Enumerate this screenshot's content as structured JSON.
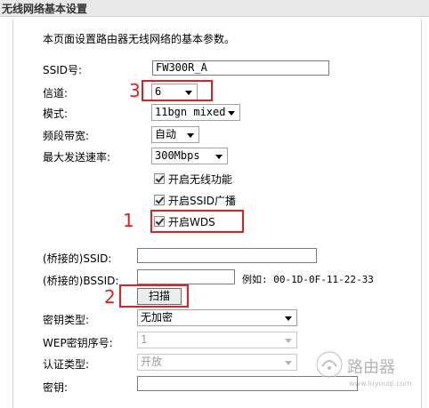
{
  "title": "无线网络基本设置",
  "intro": "本页面设置路由器无线网络的基本参数。",
  "fields": {
    "ssid": {
      "label": "SSID号:",
      "value": "FW300R_A"
    },
    "channel": {
      "label": "信道:",
      "value": "6"
    },
    "mode": {
      "label": "模式:",
      "value": "11bgn mixed"
    },
    "bandwidth": {
      "label": "频段带宽:",
      "value": "自动"
    },
    "max_rate": {
      "label": "最大发送速率:",
      "value": "300Mbps"
    }
  },
  "checkboxes": {
    "wireless": {
      "label": "开启无线功能",
      "checked": true
    },
    "ssid_broadcast": {
      "label": "开启SSID广播",
      "checked": true
    },
    "wds": {
      "label": "开启WDS",
      "checked": true
    }
  },
  "bridge": {
    "ssid_label": "(桥接的)SSID:",
    "ssid_value": "",
    "bssid_label": "(桥接的)BSSID:",
    "bssid_value": "",
    "example": "例如: 00-1D-0F-11-22-33",
    "scan_button": "扫描"
  },
  "security": {
    "key_type_label": "密钥类型:",
    "key_type_value": "无加密",
    "wep_index_label": "WEP密钥序号:",
    "wep_index_value": "1",
    "auth_type_label": "认证类型:",
    "auth_type_value": "开放",
    "key_label": "密钥:",
    "key_value": ""
  },
  "annotations": {
    "n1": "1",
    "n2": "2",
    "n3": "3"
  },
  "watermark": {
    "text": "路由器",
    "sub": "www.luyouqi.com"
  },
  "colors": {
    "annotation": "#e02020"
  }
}
